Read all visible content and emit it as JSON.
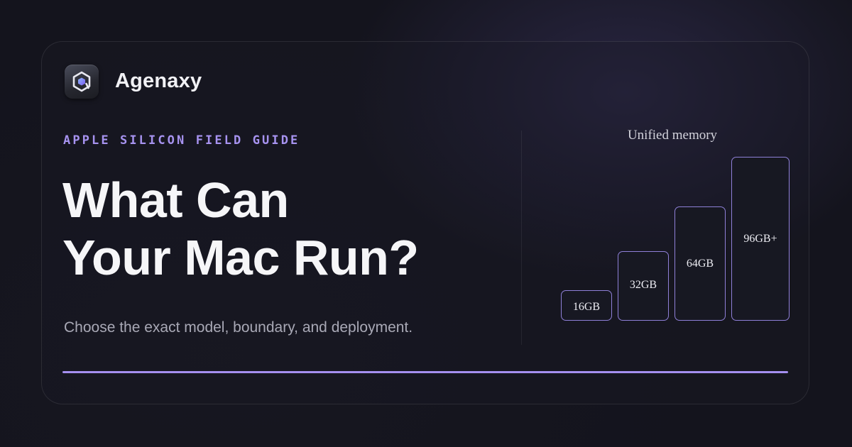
{
  "brand": {
    "name": "Agenaxy",
    "logo_icon": "hexagon-a-logo-icon",
    "logo_accent": "#7b6ff0"
  },
  "hero": {
    "eyebrow": "APPLE SILICON FIELD GUIDE",
    "title_line1": "What Can",
    "title_line2": "Your Mac Run?",
    "subtitle": "Choose the exact model, boundary, and deployment."
  },
  "memory_tiers": {
    "label": "Unified memory",
    "tiers": [
      {
        "label": "16GB"
      },
      {
        "label": "32GB"
      },
      {
        "label": "64GB"
      },
      {
        "label": "96GB+"
      }
    ]
  },
  "colors": {
    "background": "#14141d",
    "accent": "#a58ff0",
    "tier_border": "#8f80d8"
  }
}
